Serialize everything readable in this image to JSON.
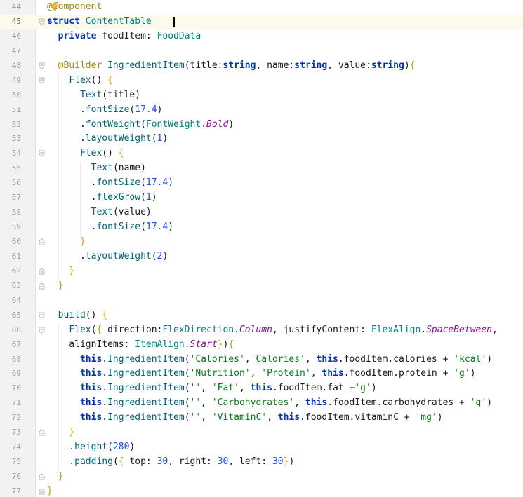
{
  "editor": {
    "colors": {
      "keyword": "#0033b3",
      "decorator": "#9e880d",
      "type": "#008080",
      "method": "#00627a",
      "string": "#067d17",
      "number": "#1750eb",
      "brace": "#c0a000",
      "plain": "#1a1a1a",
      "field": "#871094"
    },
    "lines": [
      {
        "n": "44",
        "tokens": [
          [
            "decorator",
            "@Component"
          ]
        ]
      },
      {
        "n": "45",
        "fold": "open",
        "current": true,
        "tokens": [
          [
            "keyword",
            "struct "
          ],
          [
            "type",
            "ContentTable "
          ],
          [
            "plain",
            " "
          ]
        ]
      },
      {
        "n": "46",
        "tokens": [
          [
            "plain",
            "  "
          ],
          [
            "keyword",
            "private "
          ],
          [
            "plain",
            "foodItem: "
          ],
          [
            "type",
            "FoodData"
          ]
        ]
      },
      {
        "n": "47",
        "tokens": []
      },
      {
        "n": "48",
        "fold": "open",
        "tokens": [
          [
            "plain",
            "  "
          ],
          [
            "decorator",
            "@Builder "
          ],
          [
            "method",
            "IngredientItem"
          ],
          [
            "plain",
            "(title:"
          ],
          [
            "keyword",
            "string"
          ],
          [
            "plain",
            ", name:"
          ],
          [
            "keyword",
            "string"
          ],
          [
            "plain",
            ", value:"
          ],
          [
            "keyword",
            "string"
          ],
          [
            "plain",
            ")"
          ],
          [
            "brace",
            "{"
          ]
        ]
      },
      {
        "n": "49",
        "fold": "open",
        "tokens": [
          [
            "plain",
            "    "
          ],
          [
            "method",
            "Flex"
          ],
          [
            "plain",
            "() "
          ],
          [
            "brace",
            "{"
          ]
        ]
      },
      {
        "n": "50",
        "tokens": [
          [
            "plain",
            "      "
          ],
          [
            "method",
            "Text"
          ],
          [
            "plain",
            "(title)"
          ]
        ]
      },
      {
        "n": "51",
        "tokens": [
          [
            "plain",
            "      ."
          ],
          [
            "method",
            "fontSize"
          ],
          [
            "plain",
            "("
          ],
          [
            "number",
            "17.4"
          ],
          [
            "plain",
            ")"
          ]
        ]
      },
      {
        "n": "52",
        "tokens": [
          [
            "plain",
            "      ."
          ],
          [
            "method",
            "fontWeight"
          ],
          [
            "plain",
            "("
          ],
          [
            "type",
            "FontWeight"
          ],
          [
            "plain",
            "."
          ],
          [
            "field",
            "Bold"
          ],
          [
            "plain",
            ")"
          ]
        ]
      },
      {
        "n": "53",
        "tokens": [
          [
            "plain",
            "      ."
          ],
          [
            "method",
            "layoutWeight"
          ],
          [
            "plain",
            "("
          ],
          [
            "number",
            "1"
          ],
          [
            "plain",
            ")"
          ]
        ]
      },
      {
        "n": "54",
        "fold": "open",
        "tokens": [
          [
            "plain",
            "      "
          ],
          [
            "method",
            "Flex"
          ],
          [
            "plain",
            "() "
          ],
          [
            "brace",
            "{"
          ]
        ]
      },
      {
        "n": "55",
        "tokens": [
          [
            "plain",
            "        "
          ],
          [
            "method",
            "Text"
          ],
          [
            "plain",
            "(name)"
          ]
        ]
      },
      {
        "n": "56",
        "tokens": [
          [
            "plain",
            "        ."
          ],
          [
            "method",
            "fontSize"
          ],
          [
            "plain",
            "("
          ],
          [
            "number",
            "17.4"
          ],
          [
            "plain",
            ")"
          ]
        ]
      },
      {
        "n": "57",
        "tokens": [
          [
            "plain",
            "        ."
          ],
          [
            "method",
            "flexGrow"
          ],
          [
            "plain",
            "("
          ],
          [
            "number",
            "1"
          ],
          [
            "plain",
            ")"
          ]
        ]
      },
      {
        "n": "58",
        "tokens": [
          [
            "plain",
            "        "
          ],
          [
            "method",
            "Text"
          ],
          [
            "plain",
            "(value)"
          ]
        ]
      },
      {
        "n": "59",
        "tokens": [
          [
            "plain",
            "        ."
          ],
          [
            "method",
            "fontSize"
          ],
          [
            "plain",
            "("
          ],
          [
            "number",
            "17.4"
          ],
          [
            "plain",
            ")"
          ]
        ]
      },
      {
        "n": "60",
        "fold": "close",
        "tokens": [
          [
            "plain",
            "      "
          ],
          [
            "brace",
            "}"
          ]
        ]
      },
      {
        "n": "61",
        "tokens": [
          [
            "plain",
            "      ."
          ],
          [
            "method",
            "layoutWeight"
          ],
          [
            "plain",
            "("
          ],
          [
            "number",
            "2"
          ],
          [
            "plain",
            ")"
          ]
        ]
      },
      {
        "n": "62",
        "fold": "close",
        "tokens": [
          [
            "plain",
            "    "
          ],
          [
            "brace",
            "}"
          ]
        ]
      },
      {
        "n": "63",
        "fold": "close",
        "tokens": [
          [
            "plain",
            "  "
          ],
          [
            "brace",
            "}"
          ]
        ]
      },
      {
        "n": "64",
        "tokens": []
      },
      {
        "n": "65",
        "fold": "open",
        "tokens": [
          [
            "plain",
            "  "
          ],
          [
            "method",
            "build"
          ],
          [
            "plain",
            "() "
          ],
          [
            "brace",
            "{"
          ]
        ]
      },
      {
        "n": "66",
        "fold": "open",
        "tokens": [
          [
            "plain",
            "    "
          ],
          [
            "method",
            "Flex"
          ],
          [
            "plain",
            "("
          ],
          [
            "brace",
            "{"
          ],
          [
            "plain",
            " direction:"
          ],
          [
            "type",
            "FlexDirection"
          ],
          [
            "plain",
            "."
          ],
          [
            "field",
            "Column"
          ],
          [
            "plain",
            ", justifyContent: "
          ],
          [
            "type",
            "FlexAlign"
          ],
          [
            "plain",
            "."
          ],
          [
            "field",
            "SpaceBetween"
          ],
          [
            "plain",
            ","
          ]
        ]
      },
      {
        "n": "67",
        "tokens": [
          [
            "plain",
            "    alignItems: "
          ],
          [
            "type",
            "ItemAlign"
          ],
          [
            "plain",
            "."
          ],
          [
            "field",
            "Start"
          ],
          [
            "brace",
            "}"
          ],
          [
            "plain",
            ")"
          ],
          [
            "brace",
            "{"
          ]
        ]
      },
      {
        "n": "68",
        "tokens": [
          [
            "plain",
            "      "
          ],
          [
            "keyword",
            "this"
          ],
          [
            "plain",
            "."
          ],
          [
            "method",
            "IngredientItem"
          ],
          [
            "plain",
            "("
          ],
          [
            "string",
            "'Calories'"
          ],
          [
            "plain",
            ","
          ],
          [
            "string",
            "'Calories'"
          ],
          [
            "plain",
            ", "
          ],
          [
            "keyword",
            "this"
          ],
          [
            "plain",
            ".foodItem.calories + "
          ],
          [
            "string",
            "'kcal'"
          ],
          [
            "plain",
            ")"
          ]
        ]
      },
      {
        "n": "69",
        "tokens": [
          [
            "plain",
            "      "
          ],
          [
            "keyword",
            "this"
          ],
          [
            "plain",
            "."
          ],
          [
            "method",
            "IngredientItem"
          ],
          [
            "plain",
            "("
          ],
          [
            "string",
            "'Nutrition'"
          ],
          [
            "plain",
            ", "
          ],
          [
            "string",
            "'Protein'"
          ],
          [
            "plain",
            ", "
          ],
          [
            "keyword",
            "this"
          ],
          [
            "plain",
            ".foodItem.protein + "
          ],
          [
            "string",
            "'g'"
          ],
          [
            "plain",
            ")"
          ]
        ]
      },
      {
        "n": "70",
        "tokens": [
          [
            "plain",
            "      "
          ],
          [
            "keyword",
            "this"
          ],
          [
            "plain",
            "."
          ],
          [
            "method",
            "IngredientItem"
          ],
          [
            "plain",
            "("
          ],
          [
            "string",
            "''"
          ],
          [
            "plain",
            ", "
          ],
          [
            "string",
            "'Fat'"
          ],
          [
            "plain",
            ", "
          ],
          [
            "keyword",
            "this"
          ],
          [
            "plain",
            ".foodItem.fat +"
          ],
          [
            "string",
            "'g'"
          ],
          [
            "plain",
            ")"
          ]
        ]
      },
      {
        "n": "71",
        "tokens": [
          [
            "plain",
            "      "
          ],
          [
            "keyword",
            "this"
          ],
          [
            "plain",
            "."
          ],
          [
            "method",
            "IngredientItem"
          ],
          [
            "plain",
            "("
          ],
          [
            "string",
            "''"
          ],
          [
            "plain",
            ", "
          ],
          [
            "string",
            "'Carbohydrates'"
          ],
          [
            "plain",
            ", "
          ],
          [
            "keyword",
            "this"
          ],
          [
            "plain",
            ".foodItem.carbohydrates + "
          ],
          [
            "string",
            "'g'"
          ],
          [
            "plain",
            ")"
          ]
        ]
      },
      {
        "n": "72",
        "tokens": [
          [
            "plain",
            "      "
          ],
          [
            "keyword",
            "this"
          ],
          [
            "plain",
            "."
          ],
          [
            "method",
            "IngredientItem"
          ],
          [
            "plain",
            "("
          ],
          [
            "string",
            "''"
          ],
          [
            "plain",
            ", "
          ],
          [
            "string",
            "'VitaminC'"
          ],
          [
            "plain",
            ", "
          ],
          [
            "keyword",
            "this"
          ],
          [
            "plain",
            ".foodItem.vitaminC + "
          ],
          [
            "string",
            "'mg'"
          ],
          [
            "plain",
            ")"
          ]
        ]
      },
      {
        "n": "73",
        "fold": "close",
        "tokens": [
          [
            "plain",
            "    "
          ],
          [
            "brace",
            "}"
          ]
        ]
      },
      {
        "n": "74",
        "tokens": [
          [
            "plain",
            "    ."
          ],
          [
            "method",
            "height"
          ],
          [
            "plain",
            "("
          ],
          [
            "number",
            "280"
          ],
          [
            "plain",
            ")"
          ]
        ]
      },
      {
        "n": "75",
        "tokens": [
          [
            "plain",
            "    ."
          ],
          [
            "method",
            "padding"
          ],
          [
            "plain",
            "("
          ],
          [
            "brace",
            "{"
          ],
          [
            "plain",
            " top: "
          ],
          [
            "number",
            "30"
          ],
          [
            "plain",
            ", right: "
          ],
          [
            "number",
            "30"
          ],
          [
            "plain",
            ", left: "
          ],
          [
            "number",
            "30"
          ],
          [
            "brace",
            "}"
          ],
          [
            "plain",
            ")"
          ]
        ]
      },
      {
        "n": "76",
        "fold": "close",
        "tokens": [
          [
            "plain",
            "  "
          ],
          [
            "brace",
            "}"
          ]
        ]
      },
      {
        "n": "77",
        "fold": "close",
        "tokens": [
          [
            "brace",
            "}"
          ]
        ]
      }
    ]
  }
}
